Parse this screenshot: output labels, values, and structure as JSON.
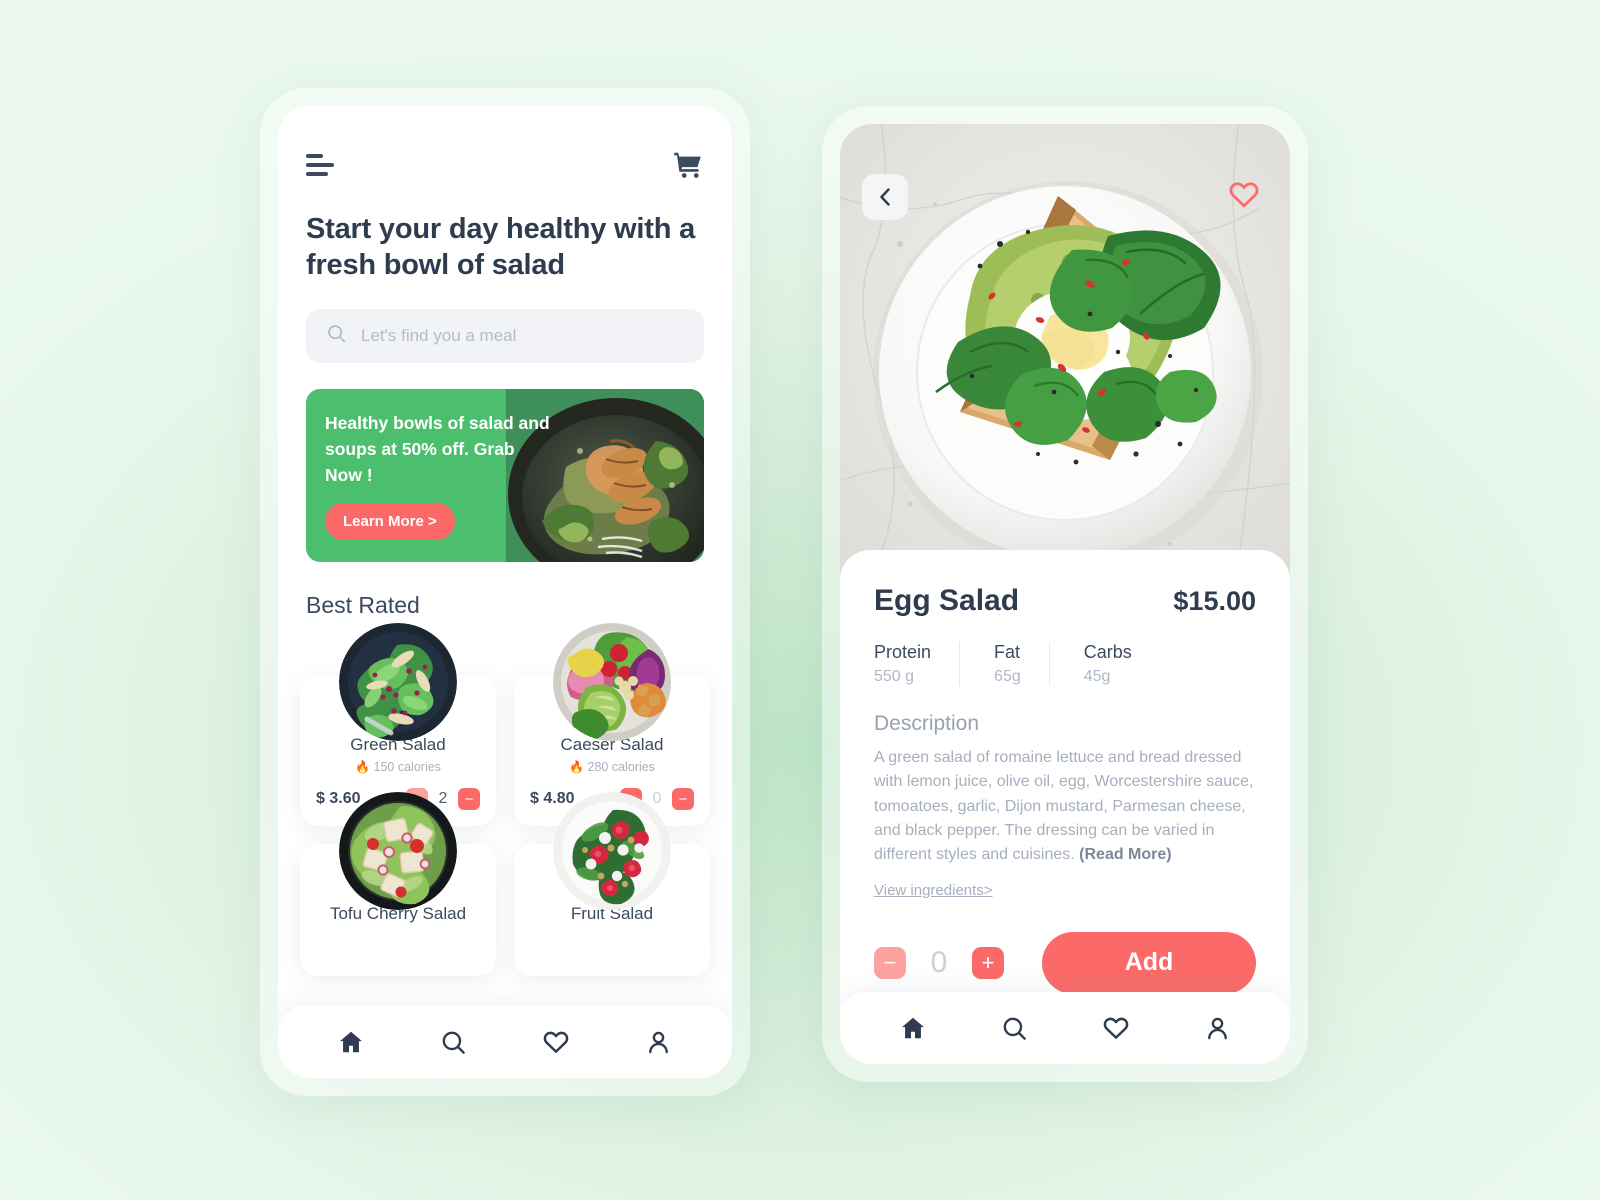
{
  "page": {
    "background_top": "#E8F7EC",
    "background_center": "#BFE6C8"
  },
  "theme": {
    "accent_red": "#FB6A68",
    "accent_red_muted": "#FCA3A0",
    "accent_green": "#4CBF6F",
    "text_dark": "#2F3C4F",
    "text_muted": "#A6AFBD"
  },
  "home": {
    "menu_icon": "hamburger-icon",
    "cart_icon": "shopping-cart-icon",
    "hero_title": "Start your day healthy with a fresh bowl of salad",
    "search": {
      "icon": "search-icon",
      "placeholder": "Let's find you a meal",
      "value": ""
    },
    "promo": {
      "text": "Healthy bowls of salad and soups at 50% off. Grab Now !",
      "cta": "Learn More >"
    },
    "section_title": "Best Rated",
    "products": [
      {
        "name": "Green Salad",
        "calories": "150 calories",
        "calorie_icon": "fire-icon",
        "price": "$ 3.60",
        "qty": "2",
        "plus_state": "muted",
        "minus_state": "solid"
      },
      {
        "name": "Caeser Salad",
        "calories": "280 calories",
        "calorie_icon": "fire-icon",
        "price": "$ 4.80",
        "qty": "0",
        "plus_state": "solid",
        "minus_state": "solid"
      },
      {
        "name": "Tofu Cherry Salad",
        "calories": "",
        "calorie_icon": "fire-icon",
        "price": "",
        "qty": "",
        "plus_state": "solid",
        "minus_state": "solid"
      },
      {
        "name": "Fruit Salad",
        "calories": "",
        "calorie_icon": "fire-icon",
        "price": "",
        "qty": "",
        "plus_state": "solid",
        "minus_state": "solid"
      }
    ],
    "nav": [
      {
        "icon": "home-icon",
        "active": true
      },
      {
        "icon": "search-icon",
        "active": false
      },
      {
        "icon": "heart-icon",
        "active": false
      },
      {
        "icon": "person-icon",
        "active": false
      }
    ]
  },
  "detail": {
    "back_icon": "chevron-left-icon",
    "favorite_icon": "heart-icon",
    "name": "Egg Salad",
    "price": "$15.00",
    "macros": [
      {
        "label": "Protein",
        "value": "550 g"
      },
      {
        "label": "Fat",
        "value": "65g"
      },
      {
        "label": "Carbs",
        "value": "45g"
      }
    ],
    "description_title": "Description",
    "description_body": "A green salad of romaine lettuce and bread dressed with lemon juice, olive oil, egg, Worcestershire sauce, tomoatoes, garlic, Dijon mustard, Parmesan cheese, and black pepper. The dressing can be varied in different styles and cuisines. ",
    "read_more": "(Read More)",
    "view_ingredients": "View ingredients>",
    "qty": "0",
    "minus_label": "−",
    "plus_label": "+",
    "add_label": "Add",
    "nav": [
      {
        "icon": "home-icon",
        "active": true
      },
      {
        "icon": "search-icon",
        "active": false
      },
      {
        "icon": "heart-icon",
        "active": false
      },
      {
        "icon": "person-icon",
        "active": false
      }
    ]
  }
}
